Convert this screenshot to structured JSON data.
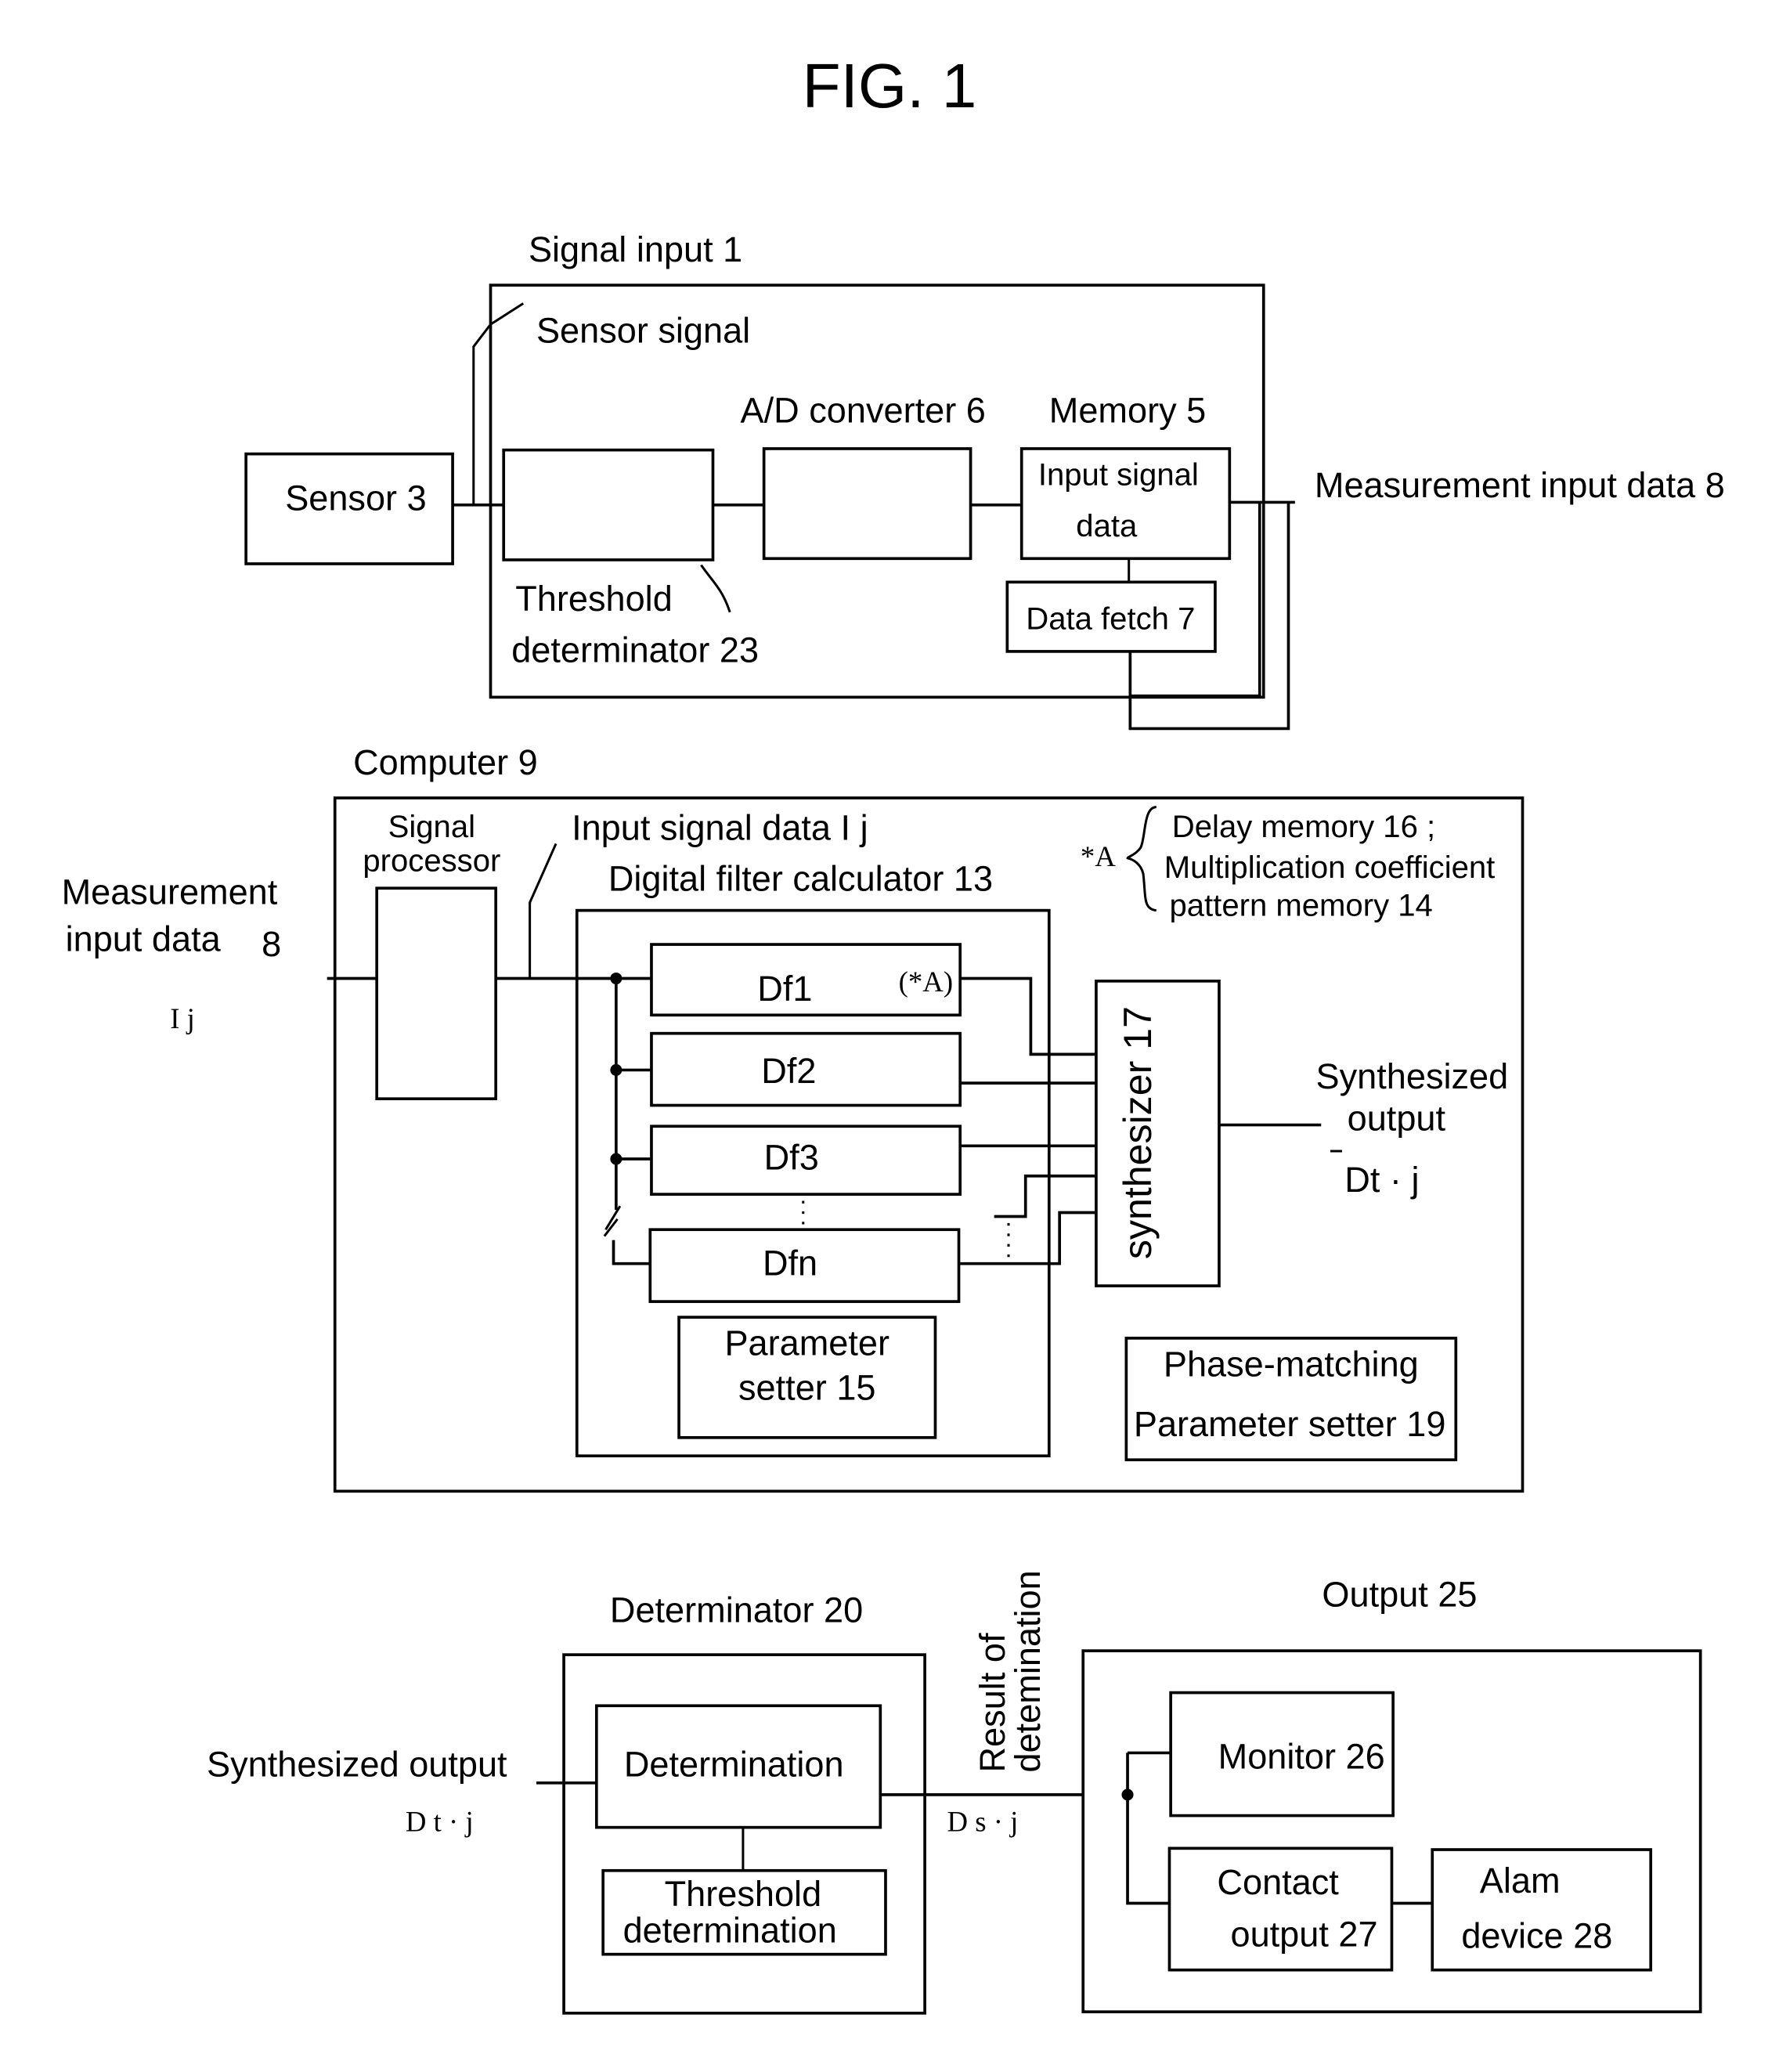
{
  "figure": {
    "title": "FIG. 1"
  },
  "signal_input": {
    "title": "Signal input 1",
    "sensor_signal_label": "Sensor signal",
    "sensor": "Sensor 3",
    "threshold_determinator": [
      "Threshold",
      "determinator 23"
    ],
    "ad_converter": "A/D converter 6",
    "memory": "Memory 5",
    "memory_content": [
      "Input signal",
      "data"
    ],
    "data_fetch": "Data fetch 7",
    "output_label": "Measurement input data 8"
  },
  "computer": {
    "title": "Computer 9",
    "input_label": [
      "Measurement",
      "input data",
      "8"
    ],
    "input_symbol": "I j",
    "signal_processor": [
      "Signal",
      "processor"
    ],
    "input_signal_data_label": "Input signal data I j",
    "digital_filter_calculator": "Digital filter calculator 13",
    "filters": [
      "Df1",
      "Df2",
      "Df3",
      "Dfn"
    ],
    "df1_note": "(*A)",
    "note_marker": "*A",
    "note_lines": [
      "Delay memory 16 ;",
      "Multiplication coefficient",
      "pattern memory 14"
    ],
    "synthesizer": "synthesizer 17",
    "parameter_setter": [
      "Parameter",
      "setter 15"
    ],
    "phase_matching": [
      "Phase-matching",
      "Parameter setter 19"
    ],
    "synthesized_output": [
      "Synthesized",
      "output"
    ],
    "synthesized_symbol": "Dt · j"
  },
  "determinator": {
    "title": "Determinator  20",
    "input_label": "Synthesized output",
    "input_symbol": "D t · j",
    "determination": "Determination",
    "threshold": [
      "Threshold",
      "determination"
    ],
    "result_label": [
      "Result of",
      "detemination"
    ],
    "result_symbol": "D s · j"
  },
  "output": {
    "title": "Output  25",
    "monitor": "Monitor 26",
    "contact_output": [
      "Contact",
      "output 27"
    ],
    "alarm_device": [
      "Alam",
      "device  28"
    ]
  }
}
